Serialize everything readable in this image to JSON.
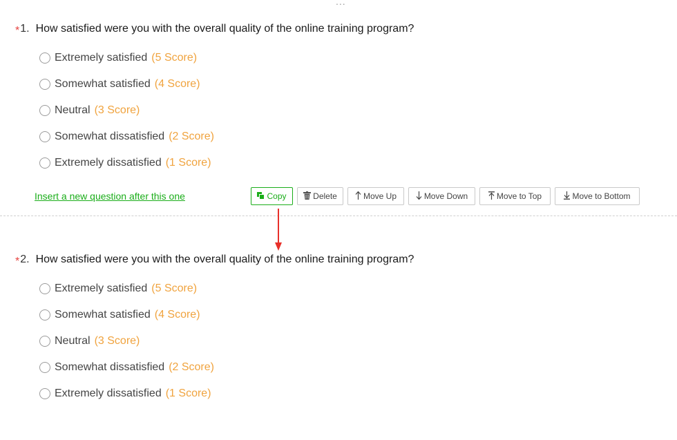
{
  "top_indicator": "...",
  "questions": [
    {
      "star": "*",
      "number": "1.",
      "title": "How satisfied were you with the overall quality of the online training program?",
      "options": [
        {
          "label": "Extremely satisfied",
          "score": "(5 Score)"
        },
        {
          "label": "Somewhat satisfied",
          "score": "(4 Score)"
        },
        {
          "label": "Neutral",
          "score": "(3 Score)"
        },
        {
          "label": "Somewhat dissatisfied",
          "score": "(2 Score)"
        },
        {
          "label": "Extremely dissatisfied",
          "score": "(1 Score)"
        }
      ]
    },
    {
      "star": "*",
      "number": "2.",
      "title": "How satisfied were you with the overall quality of the online training program?",
      "options": [
        {
          "label": "Extremely satisfied",
          "score": "(5 Score)"
        },
        {
          "label": "Somewhat satisfied",
          "score": "(4 Score)"
        },
        {
          "label": "Neutral",
          "score": "(3 Score)"
        },
        {
          "label": "Somewhat dissatisfied",
          "score": "(2 Score)"
        },
        {
          "label": "Extremely dissatisfied",
          "score": "(1 Score)"
        }
      ]
    }
  ],
  "actions": {
    "insert_link": "Insert a new question after this one",
    "buttons": [
      {
        "label": "Copy",
        "icon": "copy-icon"
      },
      {
        "label": "Delete",
        "icon": "trash-icon"
      },
      {
        "label": "Move Up",
        "icon": "arrow-up-icon"
      },
      {
        "label": "Move Down",
        "icon": "arrow-down-icon"
      },
      {
        "label": "Move to Top",
        "icon": "move-to-top-icon"
      },
      {
        "label": "Move to Bottom",
        "icon": "move-to-bottom-icon"
      }
    ]
  },
  "colors": {
    "accent_green": "#1aad19",
    "score_orange": "#f0a33e",
    "required_red": "#e64340",
    "annotation_arrow": "#e8302a"
  }
}
